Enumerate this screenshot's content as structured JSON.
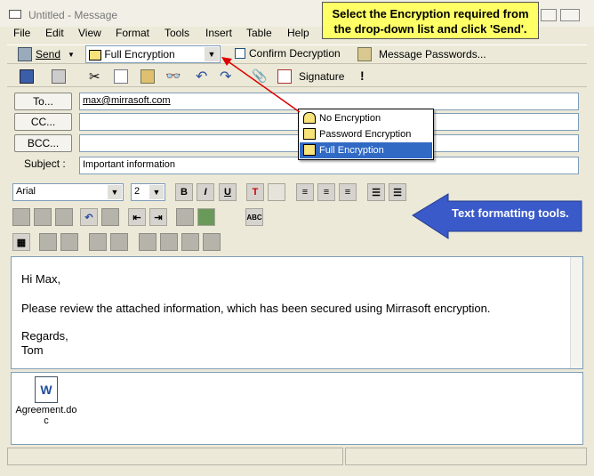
{
  "window": {
    "title": "Untitled - Message"
  },
  "menu": [
    "File",
    "Edit",
    "View",
    "Format",
    "Tools",
    "Insert",
    "Table",
    "Help"
  ],
  "toolbar1": {
    "send": "Send",
    "encryption": "Full Encryption",
    "confirm": "Confirm Decryption",
    "passwords": "Message Passwords..."
  },
  "toolbar2": {
    "signature": "Signature",
    "priority": "!"
  },
  "header": {
    "to_btn": "To...",
    "cc_btn": "CC...",
    "bcc_btn": "BCC...",
    "subject_label": "Subject :",
    "to": "max@mirrasoft.com",
    "cc": "",
    "bcc": "",
    "subject": "Important information"
  },
  "dropdown": [
    "No Encryption",
    "Password Encryption",
    "Full Encryption"
  ],
  "format": {
    "font": "Arial",
    "size": "2"
  },
  "callouts": {
    "encryption": "Select the Encryption required from the drop-down list and click 'Send'.",
    "formatting": "Text formatting tools."
  },
  "body": {
    "line1": "Hi Max,",
    "line2": "Please review the attached information, which has been secured using Mirrasoft encryption.",
    "line3": "Regards,",
    "line4": "Tom"
  },
  "attachment": {
    "name_line1": "Agreement.do",
    "name_line2": "c"
  },
  "colors": {
    "selection": "#316ac5",
    "callout_yellow": "#ffff66",
    "callout_blue": "#3a5ac9"
  }
}
